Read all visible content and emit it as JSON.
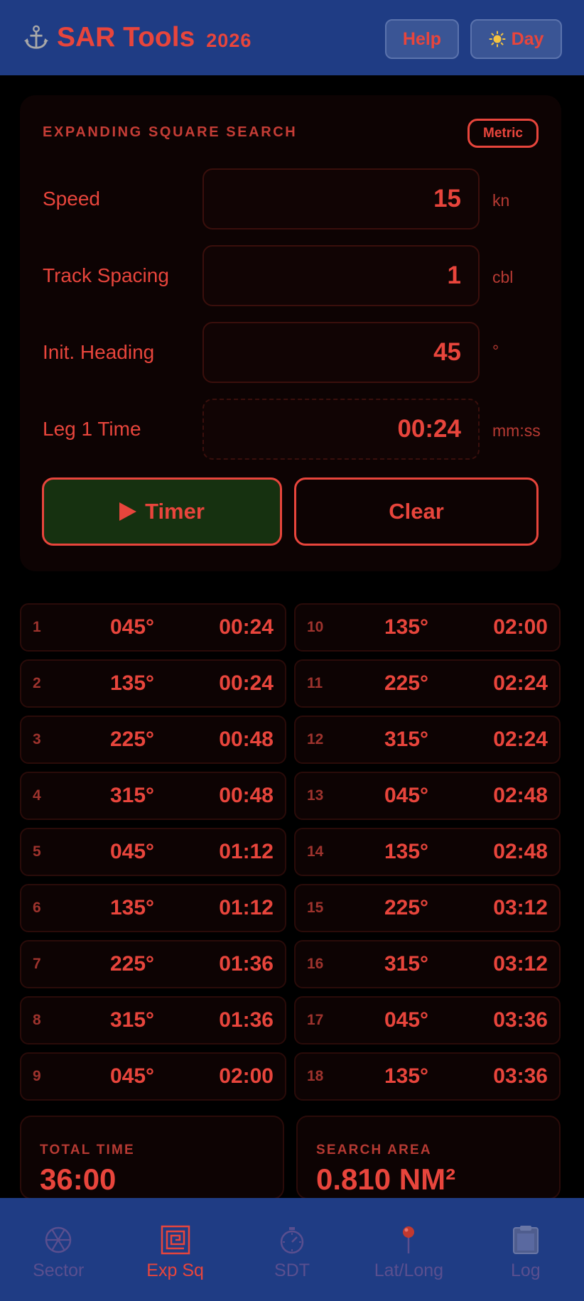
{
  "header": {
    "title": "SAR Tools",
    "year": "2026",
    "help_label": "Help",
    "day_label": "Day"
  },
  "card": {
    "title": "EXPANDING SQUARE SEARCH",
    "units_badge": "Metric",
    "fields": [
      {
        "label": "Speed",
        "value": "15",
        "unit": "kn"
      },
      {
        "label": "Track Spacing",
        "value": "1",
        "unit": "cbl"
      },
      {
        "label": "Init. Heading",
        "value": "45",
        "unit": "°"
      },
      {
        "label": "Leg 1 Time",
        "value": "00:24",
        "unit": "mm:ss"
      }
    ],
    "timer_label": "Timer",
    "clear_label": "Clear"
  },
  "legs": [
    {
      "n": "1",
      "hdg": "045°",
      "time": "00:24"
    },
    {
      "n": "2",
      "hdg": "135°",
      "time": "00:24"
    },
    {
      "n": "3",
      "hdg": "225°",
      "time": "00:48"
    },
    {
      "n": "4",
      "hdg": "315°",
      "time": "00:48"
    },
    {
      "n": "5",
      "hdg": "045°",
      "time": "01:12"
    },
    {
      "n": "6",
      "hdg": "135°",
      "time": "01:12"
    },
    {
      "n": "7",
      "hdg": "225°",
      "time": "01:36"
    },
    {
      "n": "8",
      "hdg": "315°",
      "time": "01:36"
    },
    {
      "n": "9",
      "hdg": "045°",
      "time": "02:00"
    },
    {
      "n": "10",
      "hdg": "135°",
      "time": "02:00"
    },
    {
      "n": "11",
      "hdg": "225°",
      "time": "02:24"
    },
    {
      "n": "12",
      "hdg": "315°",
      "time": "02:24"
    },
    {
      "n": "13",
      "hdg": "045°",
      "time": "02:48"
    },
    {
      "n": "14",
      "hdg": "135°",
      "time": "02:48"
    },
    {
      "n": "15",
      "hdg": "225°",
      "time": "03:12"
    },
    {
      "n": "16",
      "hdg": "315°",
      "time": "03:12"
    },
    {
      "n": "17",
      "hdg": "045°",
      "time": "03:36"
    },
    {
      "n": "18",
      "hdg": "135°",
      "time": "03:36"
    }
  ],
  "summary": {
    "total_time_label": "TOTAL TIME",
    "total_time": "36:00",
    "search_area_label": "SEARCH AREA",
    "search_area": "0.810 NM²"
  },
  "nav": [
    {
      "label": "Sector",
      "icon": "sector-icon",
      "active": false
    },
    {
      "label": "Exp Sq",
      "icon": "expanding-square-icon",
      "active": true
    },
    {
      "label": "SDT",
      "icon": "stopwatch-icon",
      "active": false
    },
    {
      "label": "Lat/Long",
      "icon": "pin-icon",
      "active": false
    },
    {
      "label": "Log",
      "icon": "clipboard-icon",
      "active": false
    }
  ],
  "colors": {
    "accent": "#e8453c",
    "header_bg": "#1f3c84",
    "background": "#000000",
    "timer_bg": "#163110"
  }
}
